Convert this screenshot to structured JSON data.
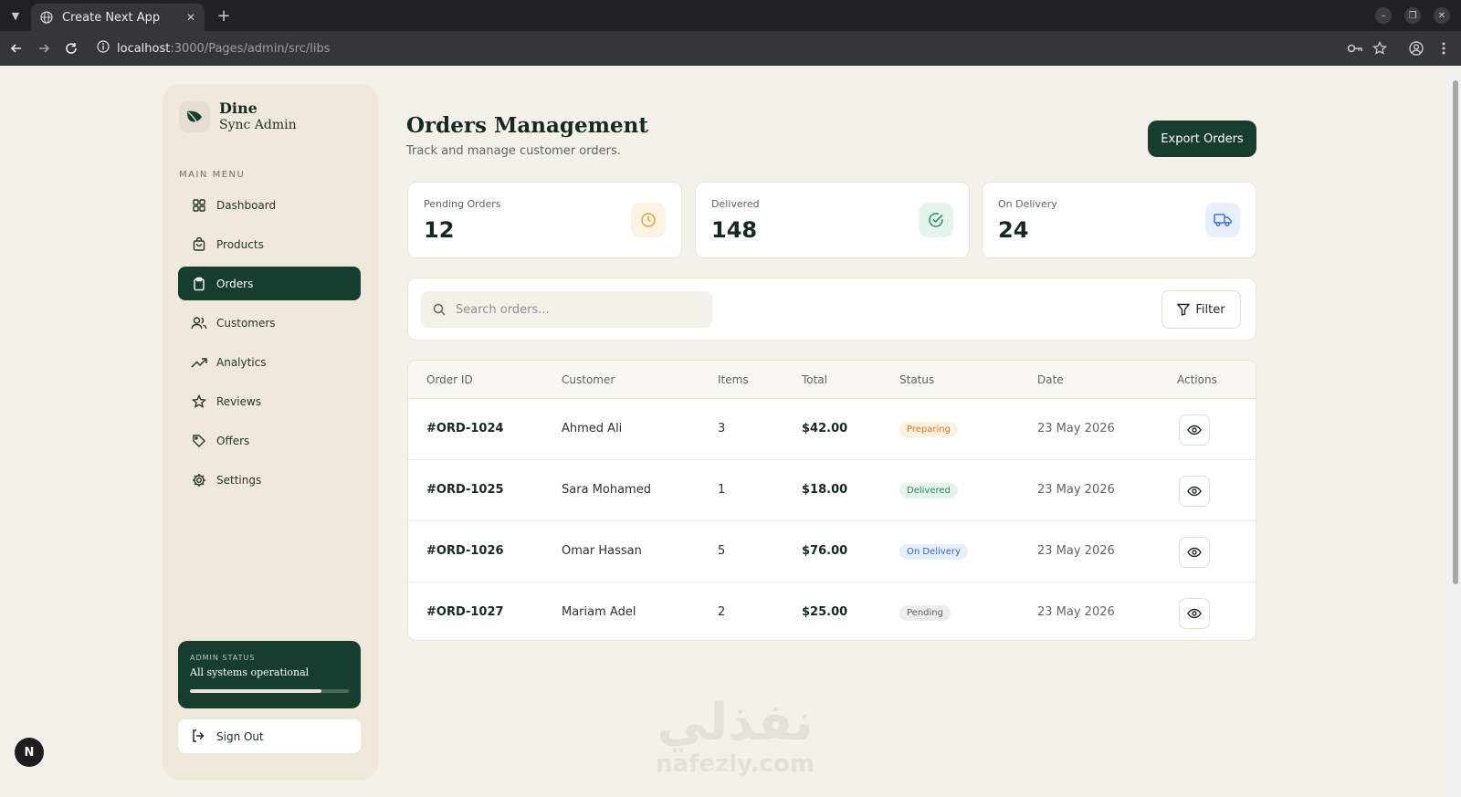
{
  "browser": {
    "tab_title": "Create Next App",
    "url_host": "localhost",
    "url_path": ":3000/Pages/admin/src/libs"
  },
  "sidebar": {
    "brand_name": "Dine",
    "brand_sub": "Sync Admin",
    "menu_label": "MAIN MENU",
    "items": [
      {
        "label": "Dashboard",
        "icon": "grid-icon"
      },
      {
        "label": "Products",
        "icon": "bag-icon"
      },
      {
        "label": "Orders",
        "icon": "clipboard-icon",
        "active": true
      },
      {
        "label": "Customers",
        "icon": "users-icon"
      },
      {
        "label": "Analytics",
        "icon": "trending-up-icon"
      },
      {
        "label": "Reviews",
        "icon": "star-icon"
      },
      {
        "label": "Offers",
        "icon": "tag-icon"
      },
      {
        "label": "Settings",
        "icon": "gear-icon"
      }
    ],
    "status": {
      "label": "ADMIN STATUS",
      "text": "All systems operational",
      "progress_percent": 83
    },
    "signout_label": "Sign Out"
  },
  "header": {
    "title": "Orders Management",
    "subtitle": "Track and manage customer orders.",
    "export_label": "Export Orders"
  },
  "stats": [
    {
      "label": "Pending Orders",
      "value": "12",
      "icon": "clock-icon",
      "color": "#e8a33d",
      "bg": "#fdf3e4"
    },
    {
      "label": "Delivered",
      "value": "148",
      "icon": "check-circle-icon",
      "color": "#2f9a5c",
      "bg": "#e6f5ec"
    },
    {
      "label": "On Delivery",
      "value": "24",
      "icon": "truck-icon",
      "color": "#3b74d9",
      "bg": "#e8f0fd"
    }
  ],
  "search": {
    "placeholder": "Search orders...",
    "filter_label": "Filter"
  },
  "table": {
    "columns": [
      "Order ID",
      "Customer",
      "Items",
      "Total",
      "Status",
      "Date",
      "Actions"
    ],
    "rows": [
      {
        "id": "#ORD-1024",
        "customer": "Ahmed Ali",
        "items": "3",
        "total": "$42.00",
        "status": "Preparing",
        "date": "23 May 2026"
      },
      {
        "id": "#ORD-1025",
        "customer": "Sara Mohamed",
        "items": "1",
        "total": "$18.00",
        "status": "Delivered",
        "date": "23 May 2026"
      },
      {
        "id": "#ORD-1026",
        "customer": "Omar Hassan",
        "items": "5",
        "total": "$76.00",
        "status": "On Delivery",
        "date": "23 May 2026"
      },
      {
        "id": "#ORD-1027",
        "customer": "Mariam Adel",
        "items": "2",
        "total": "$25.00",
        "status": "Pending",
        "date": "23 May 2026"
      }
    ]
  },
  "status_colors": {
    "Preparing": {
      "fg": "#d97a1c",
      "bg": "#fdf1e0"
    },
    "Delivered": {
      "fg": "#2a8a52",
      "bg": "#e3f4ea"
    },
    "On Delivery": {
      "fg": "#3468c9",
      "bg": "#e6eefc"
    },
    "Pending": {
      "fg": "#5c615c",
      "bg": "#efedea"
    }
  },
  "watermark": {
    "arabic": "نفذلي",
    "latin": "nafezly.com"
  }
}
